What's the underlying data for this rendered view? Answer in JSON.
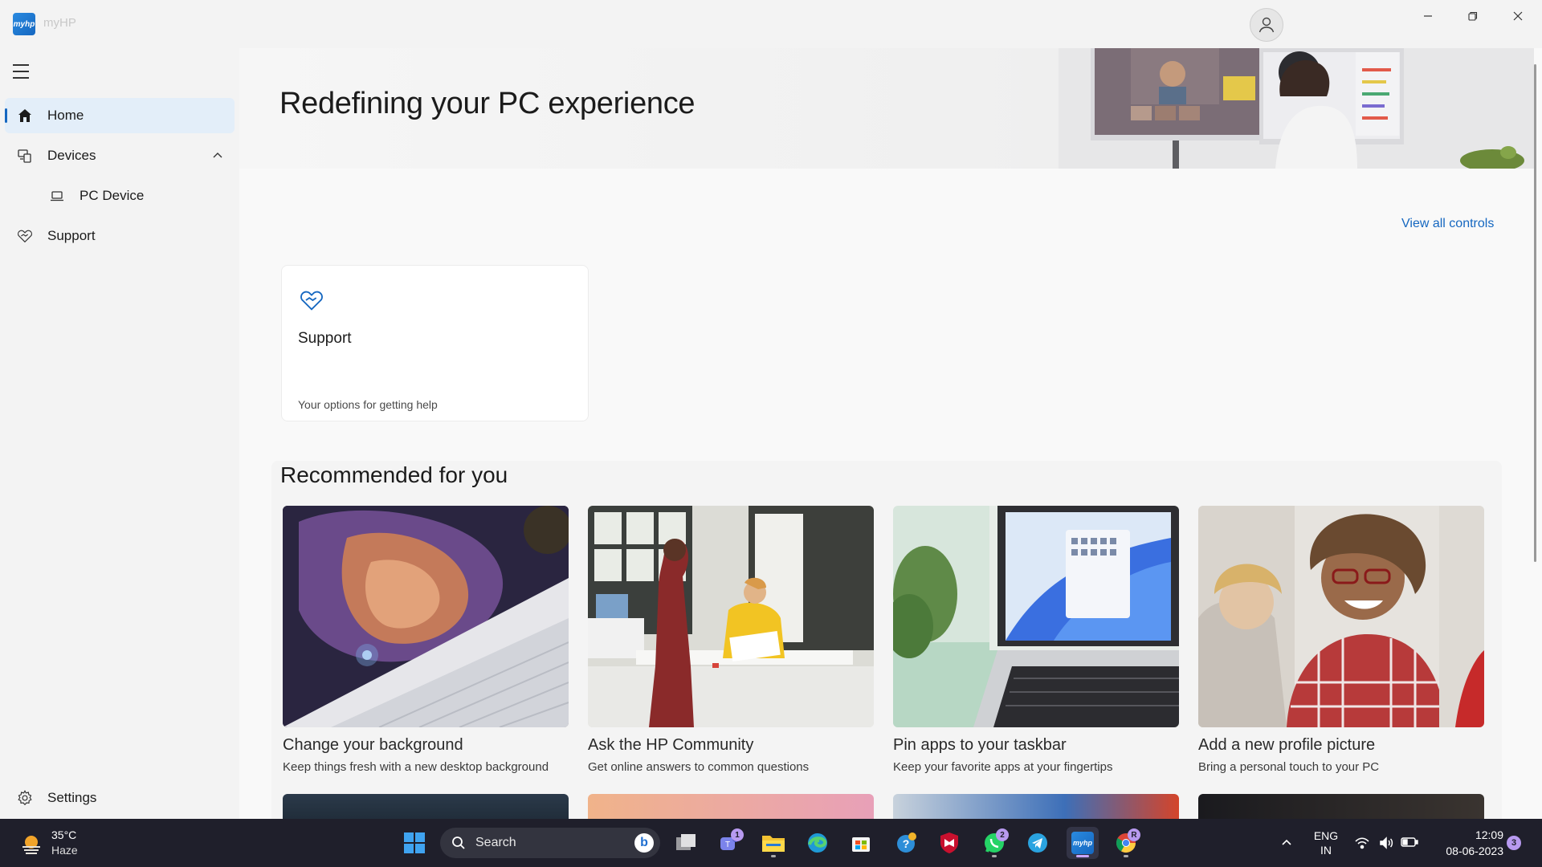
{
  "app": {
    "title": "myHP",
    "logo_text": "myhp"
  },
  "sidebar": {
    "items": [
      {
        "label": "Home",
        "icon": "home-icon",
        "active": true
      },
      {
        "label": "Devices",
        "icon": "devices-icon",
        "expanded": true
      },
      {
        "label": "PC Device",
        "icon": "laptop-icon"
      },
      {
        "label": "Support",
        "icon": "support-icon"
      }
    ],
    "settings_label": "Settings"
  },
  "main": {
    "hero_title": "Redefining your PC experience",
    "view_all_label": "View all controls",
    "support_card": {
      "title": "Support",
      "description": "Your options for getting help"
    },
    "recommended": {
      "title": "Recommended for you",
      "cards": [
        {
          "title": "Change your background",
          "description": "Keep things fresh with a new desktop background"
        },
        {
          "title": "Ask the HP Community",
          "description": "Get online answers to common questions"
        },
        {
          "title": "Pin apps to your taskbar",
          "description": "Keep your favorite apps at your fingertips"
        },
        {
          "title": "Add a new profile picture",
          "description": "Bring a personal touch to your PC"
        }
      ]
    }
  },
  "taskbar": {
    "weather": {
      "temp": "35°C",
      "condition": "Haze"
    },
    "search_label": "Search",
    "badges": {
      "teams": "1",
      "whatsapp": "2",
      "chrome": "R",
      "notifications": "3"
    },
    "language": {
      "line1": "ENG",
      "line2": "IN"
    },
    "clock": {
      "time": "12:09",
      "date": "08-06-2023"
    }
  },
  "colors": {
    "accent": "#1567c0",
    "active_nav_bg": "#e3eef9",
    "taskbar_bg": "#1f1f2b"
  }
}
